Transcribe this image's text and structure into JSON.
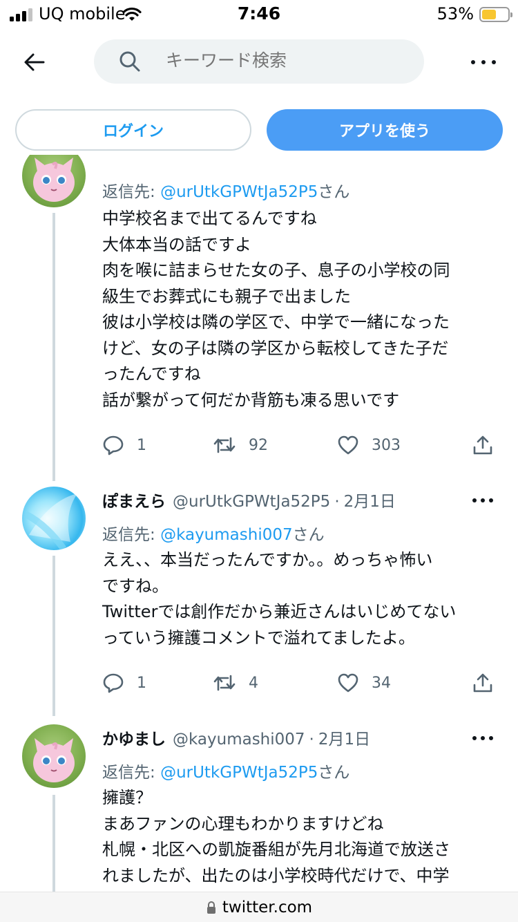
{
  "status_bar": {
    "carrier": "UQ mobile",
    "time": "7:46",
    "battery_percent": "53%",
    "battery_level": 0.53
  },
  "header": {
    "search_placeholder": "キーワード検索"
  },
  "auth": {
    "login_label": "ログイン",
    "app_label": "アプリを使う"
  },
  "tweets": [
    {
      "reply_prefix": "返信先: ",
      "reply_mention": "@urUtkGPWtJa52P5",
      "reply_suffix": "さん",
      "lines": [
        "中学校名まで出てるんですね",
        "大体本当の話ですよ",
        "肉を喉に詰まらせた女の子、息子の小学校の同",
        "級生でお葬式にも親子で出ました",
        "彼は小学校は隣の学区で、中学で一緒になった",
        "けど、女の子は隣の学区から転校してきた子だ",
        "ったんですね",
        "話が繋がって何だか背筋も凍る思いです"
      ],
      "replies": "1",
      "retweets": "92",
      "likes": "303"
    },
    {
      "display_name": "ぽまえら",
      "handle": "@urUtkGPWtJa52P5",
      "separator": "·",
      "date": "2月1日",
      "reply_prefix": "返信先: ",
      "reply_mention": "@kayumashi007",
      "reply_suffix": "さん",
      "lines": [
        "ええ、、本当だったんですか。。めっちゃ怖い",
        "ですね。",
        "Twitterでは創作だから兼近さんはいじめてない",
        "っていう擁護コメントで溢れてましたよ。"
      ],
      "replies": "1",
      "retweets": "4",
      "likes": "34"
    },
    {
      "display_name": "かゆまし",
      "handle": "@kayumashi007",
      "separator": "·",
      "date": "2月1日",
      "reply_prefix": "返信先: ",
      "reply_mention": "@urUtkGPWtJa52P5",
      "reply_suffix": "さん",
      "lines": [
        "擁護？",
        "まあファンの心理もわかりますけどね",
        "札幌・北区への凱旋番組が先月北海道で放送さ",
        "れましたが、出たのは小学校時代だけで、中学"
      ]
    }
  ],
  "url_bar": {
    "url": "twitter.com"
  },
  "colors": {
    "accent": "#1d9bf0",
    "app_button": "#4b9df5",
    "secondary_text": "#536471",
    "thread_line": "#cfd9de"
  }
}
